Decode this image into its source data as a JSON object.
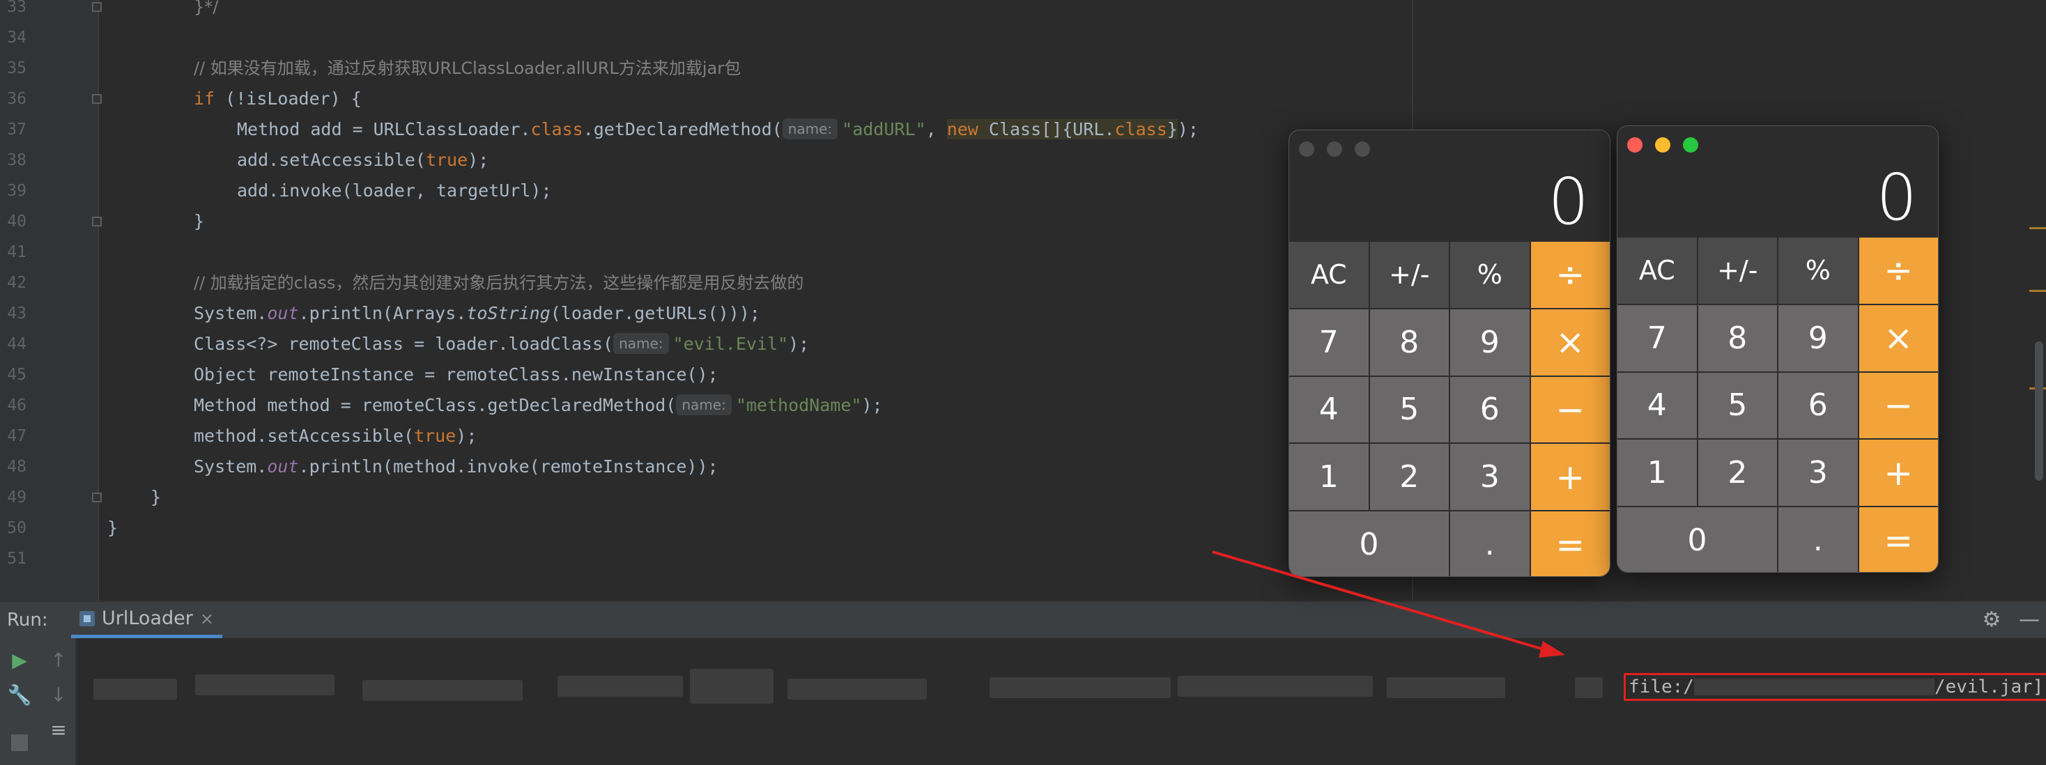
{
  "editor": {
    "lines": [
      {
        "n": "33",
        "fold": true,
        "tokens": [
          {
            "t": "}*/",
            "c": "cm"
          }
        ]
      },
      {
        "n": "34",
        "tokens": []
      },
      {
        "n": "35",
        "tokens": [
          {
            "t": "// 如果没有加载，通过反射获取URLClassLoader.allURL方法来加载jar包",
            "c": "cm"
          }
        ]
      },
      {
        "n": "36",
        "fold": true,
        "tokens": [
          {
            "t": "if",
            "c": "kw"
          },
          {
            "t": " (!isLoader) {",
            "c": ""
          }
        ]
      },
      {
        "n": "37",
        "tokens": [
          {
            "t": "Method add = URLClassLoader.",
            "c": ""
          },
          {
            "t": "class",
            "c": "kw"
          },
          {
            "t": ".getDeclaredMethod(",
            "c": ""
          },
          {
            "t": "name:",
            "c": "hint"
          },
          {
            "t": "\"addURL\"",
            "c": "str"
          },
          {
            "t": ", ",
            "c": ""
          },
          {
            "t": "new",
            "c": "kw hl"
          },
          {
            "t": " Class[]{URL.",
            "c": "hl"
          },
          {
            "t": "class",
            "c": "kw hl"
          },
          {
            "t": "}",
            "c": "hl"
          },
          {
            "t": ");",
            "c": ""
          }
        ]
      },
      {
        "n": "38",
        "tokens": [
          {
            "t": "add.setAccessible(",
            "c": ""
          },
          {
            "t": "true",
            "c": "kw"
          },
          {
            "t": ");",
            "c": ""
          }
        ]
      },
      {
        "n": "39",
        "tokens": [
          {
            "t": "add.invoke(loader, targetUrl);",
            "c": ""
          }
        ]
      },
      {
        "n": "40",
        "fold": true,
        "tokens": [
          {
            "t": "}",
            "c": ""
          }
        ]
      },
      {
        "n": "41",
        "tokens": []
      },
      {
        "n": "42",
        "tokens": [
          {
            "t": "// 加载指定的class，然后为其创建对象后执行其方法，这些操作都是用反射去做的",
            "c": "cm"
          }
        ]
      },
      {
        "n": "43",
        "tokens": [
          {
            "t": "System.",
            "c": ""
          },
          {
            "t": "out",
            "c": "fld"
          },
          {
            "t": ".println(Arrays.",
            "c": ""
          },
          {
            "t": "toString",
            "c": "it"
          },
          {
            "t": "(loader.getURLs()));",
            "c": ""
          }
        ]
      },
      {
        "n": "44",
        "tokens": [
          {
            "t": "Class<?> remoteClass = loader.loadClass(",
            "c": ""
          },
          {
            "t": "name:",
            "c": "hint"
          },
          {
            "t": "\"evil.Evil\"",
            "c": "str"
          },
          {
            "t": ");",
            "c": ""
          }
        ]
      },
      {
        "n": "45",
        "tokens": [
          {
            "t": "Object remoteInstance = remoteClass.newInstance();",
            "c": ""
          }
        ]
      },
      {
        "n": "46",
        "tokens": [
          {
            "t": "Method method = remoteClass.getDeclaredMethod(",
            "c": ""
          },
          {
            "t": "name:",
            "c": "hint"
          },
          {
            "t": "\"methodName\"",
            "c": "str"
          },
          {
            "t": ");",
            "c": ""
          }
        ]
      },
      {
        "n": "47",
        "tokens": [
          {
            "t": "method.setAccessible(",
            "c": ""
          },
          {
            "t": "true",
            "c": "kw"
          },
          {
            "t": ");",
            "c": ""
          }
        ]
      },
      {
        "n": "48",
        "tokens": [
          {
            "t": "System.",
            "c": ""
          },
          {
            "t": "out",
            "c": "fld"
          },
          {
            "t": ".println(method.invoke(remoteInstance));",
            "c": ""
          }
        ]
      },
      {
        "n": "49",
        "fold": true,
        "tokens": [
          {
            "t": "}",
            "c": ""
          }
        ]
      },
      {
        "n": "50",
        "tokens": [
          {
            "t": "}",
            "c": ""
          }
        ]
      },
      {
        "n": "51",
        "tokens": []
      }
    ]
  },
  "run": {
    "label": "Run:",
    "tab_label": "UrlLoader",
    "tab_close": "×",
    "settings_icon": "⚙",
    "minimize_icon": "—",
    "output_prefix": "file:/",
    "output_suffix": "/evil.jar]"
  },
  "calculators": [
    {
      "display": "0",
      "active": false,
      "keys": [
        "AC",
        "+/-",
        "%",
        "÷",
        "7",
        "8",
        "9",
        "×",
        "4",
        "5",
        "6",
        "−",
        "1",
        "2",
        "3",
        "+",
        "0",
        ".",
        "="
      ]
    },
    {
      "display": "0",
      "active": true,
      "keys": [
        "AC",
        "+/-",
        "%",
        "÷",
        "7",
        "8",
        "9",
        "×",
        "4",
        "5",
        "6",
        "−",
        "1",
        "2",
        "3",
        "+",
        "0",
        ".",
        "="
      ]
    }
  ],
  "colors": {
    "accent_orange": "#f2a33a",
    "annotation_red": "#e02020",
    "traffic_red": "#ff5f57",
    "traffic_yellow": "#febc2e",
    "traffic_green": "#28c840"
  }
}
